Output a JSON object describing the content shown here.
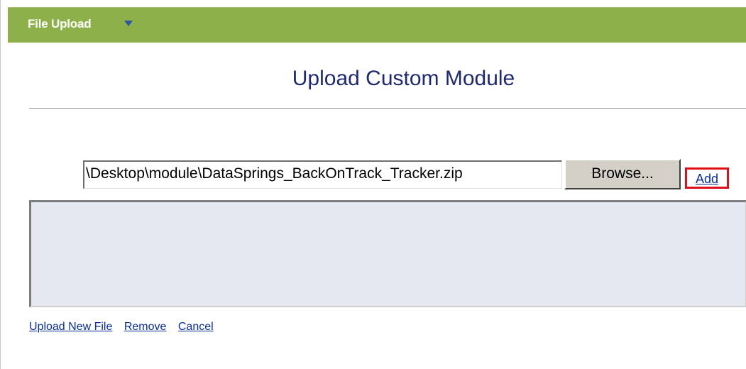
{
  "header": {
    "title": "File Upload",
    "dropdown_icon": "caret-down-icon"
  },
  "main": {
    "title": "Upload Custom Module",
    "file_input_value": "\\Desktop\\module\\DataSprings_BackOnTrack_Tracker.zip",
    "browse_label": "Browse...",
    "add_label": "Add",
    "actions": [
      {
        "label": "Upload New File"
      },
      {
        "label": "Remove"
      },
      {
        "label": "Cancel"
      }
    ]
  },
  "colors": {
    "header_bg": "#8db04a",
    "title_text": "#1f2a6e",
    "link": "#0a2f99",
    "highlight": "#e0101a",
    "list_bg": "#e5e8f1"
  }
}
